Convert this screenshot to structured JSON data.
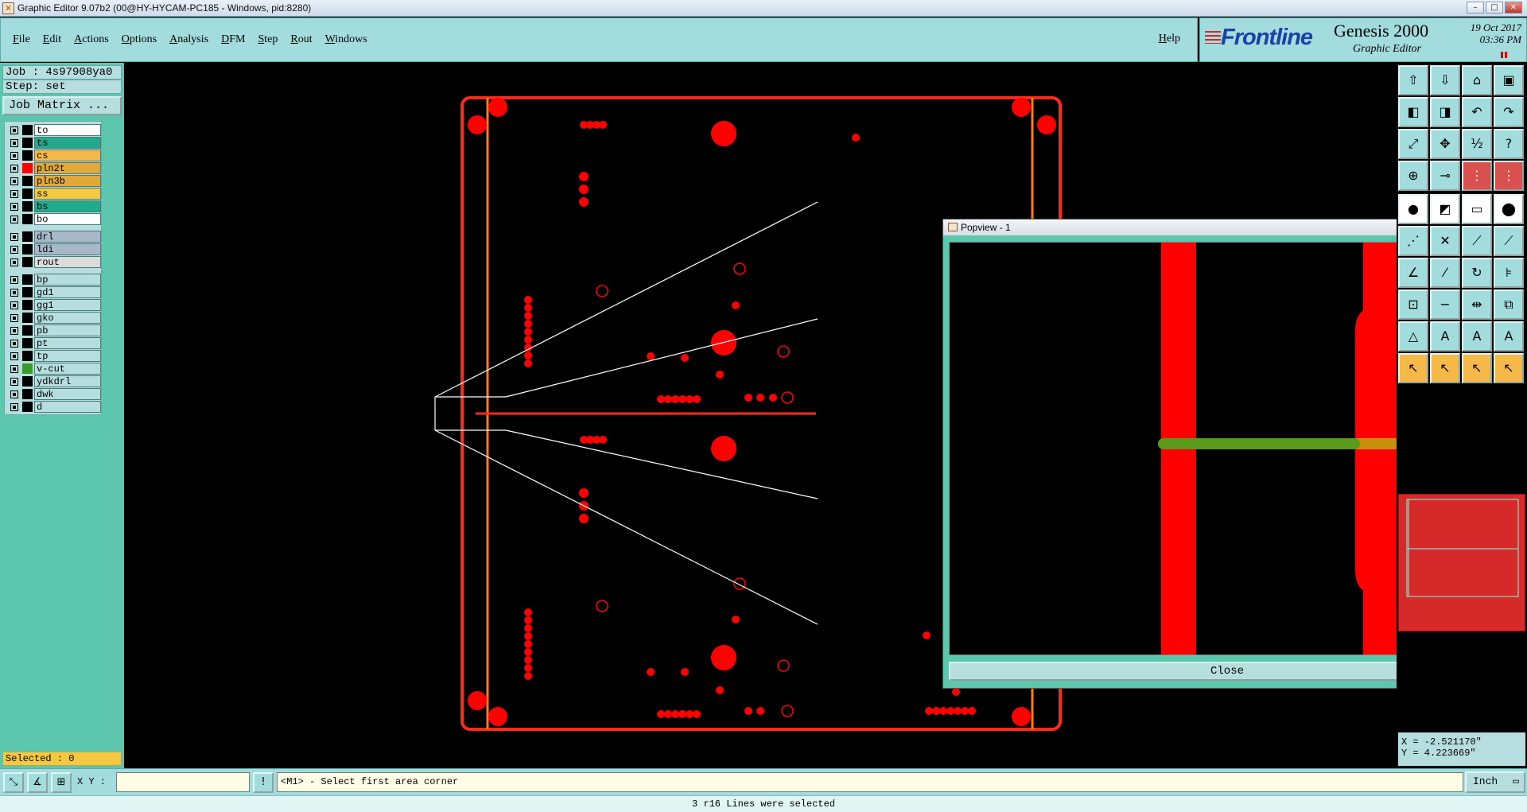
{
  "window": {
    "title": "Graphic Editor 9.07b2 (00@HY-HYCAM-PC185 - Windows, pid:8280)"
  },
  "menu": {
    "items": [
      "File",
      "Edit",
      "Actions",
      "Options",
      "Analysis",
      "DFM",
      "Step",
      "Rout",
      "Windows"
    ],
    "help": "Help"
  },
  "brand": {
    "logo": "Frontline",
    "product": "Genesis 2000",
    "subtitle": "Graphic Editor",
    "date": "19 Oct 2017",
    "time": "03:36 PM"
  },
  "job": {
    "name": "Job : 4s97908ya0",
    "step": "Step: set",
    "matrix_button": "Job Matrix ..."
  },
  "layers": [
    {
      "name": "to",
      "color": "#ffffff",
      "swatch": "#000000"
    },
    {
      "name": "ts",
      "color": "#22a88a",
      "swatch": "#000000"
    },
    {
      "name": "cs",
      "color": "#f5b94a",
      "swatch": "#000000"
    },
    {
      "name": "pln2t",
      "color": "#e0a93a",
      "swatch": "#ff0000"
    },
    {
      "name": "pln3b",
      "color": "#e0a93a",
      "swatch": "#000000"
    },
    {
      "name": "ss",
      "color": "#f5c842",
      "swatch": "#000000"
    },
    {
      "name": "bs",
      "color": "#22a88a",
      "swatch": "#000000"
    },
    {
      "name": "bo",
      "color": "#ffffff",
      "swatch": "#000000"
    },
    {
      "name": "drl",
      "color": "#a8b8c8",
      "swatch": "#000000"
    },
    {
      "name": "ldi",
      "color": "#a8b8c8",
      "swatch": "#000000"
    },
    {
      "name": "rout",
      "color": "#dcdcdc",
      "swatch": "#000000"
    },
    {
      "name": "bp",
      "color": "#b6dede",
      "swatch": "#000000"
    },
    {
      "name": "gd1",
      "color": "#b6dede",
      "swatch": "#000000"
    },
    {
      "name": "gg1",
      "color": "#b6dede",
      "swatch": "#000000"
    },
    {
      "name": "gko",
      "color": "#b6dede",
      "swatch": "#000000"
    },
    {
      "name": "pb",
      "color": "#b6dede",
      "swatch": "#000000"
    },
    {
      "name": "pt",
      "color": "#b6dede",
      "swatch": "#000000"
    },
    {
      "name": "tp",
      "color": "#b6dede",
      "swatch": "#000000"
    },
    {
      "name": "v-cut",
      "color": "#b6dede",
      "swatch": "#3a9a2a"
    },
    {
      "name": "ydkdrl",
      "color": "#b6dede",
      "swatch": "#000000"
    },
    {
      "name": "dwk",
      "color": "#b6dede",
      "swatch": "#000000"
    },
    {
      "name": "d",
      "color": "#b6dede",
      "swatch": "#000000"
    }
  ],
  "selected": "Selected : 0",
  "popview": {
    "title": "Popview - 1",
    "close_label": "Close"
  },
  "coords": {
    "x": "X = -2.521170\"",
    "y": "Y = 4.223669\""
  },
  "bottom": {
    "xy_label": "X Y :",
    "prompt": "<M1> - Select first area corner",
    "unit": "Inch"
  },
  "status": "3 r16 Lines were selected",
  "colors": {
    "panel": "#a3dcdc",
    "accent": "#5dc7ad",
    "copper": "#ff0000",
    "outline": "#ff4a1a",
    "vcut": "#5a9a1a"
  }
}
